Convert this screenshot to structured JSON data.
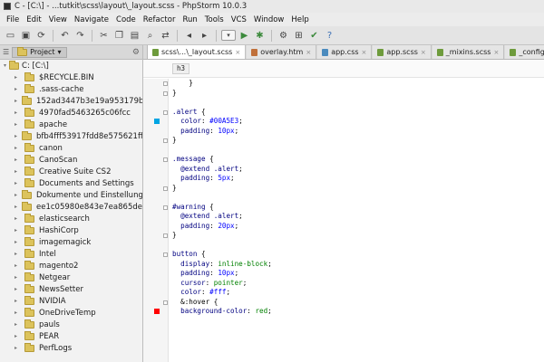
{
  "window": {
    "title": "C - [C:\\] - ...tutkit\\scss\\layout\\_layout.scss - PhpStorm 10.0.3"
  },
  "menu": [
    "File",
    "Edit",
    "View",
    "Navigate",
    "Code",
    "Refactor",
    "Run",
    "Tools",
    "VCS",
    "Window",
    "Help"
  ],
  "toolbar": {
    "icons": [
      "folder-open-icon",
      "save-icon",
      "sync-icon",
      "undo-icon",
      "redo-icon",
      "cut-icon",
      "copy-icon",
      "paste-icon",
      "find-icon",
      "replace-icon",
      "back-icon",
      "forward-icon",
      "run-config-icon",
      "run-icon",
      "debug-icon",
      "settings-icon",
      "project-structure-icon",
      "vcs-icon",
      "help-icon"
    ]
  },
  "project_panel": {
    "tab_label": "Project",
    "root": "C: [C:\\]",
    "items": [
      "$RECYCLE.BIN",
      ".sass-cache",
      "152ad3447b3e19a953179b5bbc7a",
      "4970fad5463265c06fcc",
      "apache",
      "bfb4fff53917fdd8e575621ff0286a",
      "canon",
      "CanoScan",
      "Creative Suite CS2",
      "Documents and Settings",
      "Dokumente und Einstellungen",
      "ee1c05980e843e7ea865de091f68b",
      "elasticsearch",
      "HashiCorp",
      "imagemagick",
      "Intel",
      "magento2",
      "Netgear",
      "NewsSetter",
      "NVIDIA",
      "OneDriveTemp",
      "pauls",
      "PEAR",
      "PerfLogs"
    ]
  },
  "tabs": [
    {
      "label": "scss\\...\\_layout.scss",
      "type": "scss",
      "active": true
    },
    {
      "label": "overlay.htm",
      "type": "html",
      "active": false
    },
    {
      "label": "app.css",
      "type": "css",
      "active": false
    },
    {
      "label": "app.scss",
      "type": "scss",
      "active": false
    },
    {
      "label": "_mixins.scss",
      "type": "scss",
      "active": false
    },
    {
      "label": "_config.scss",
      "type": "scss",
      "active": false
    }
  ],
  "breadcrumb": "h3",
  "code": {
    "lines": [
      [
        [
          "plain",
          "    }"
        ]
      ],
      [
        [
          "plain",
          "}"
        ]
      ],
      [
        [
          "plain",
          ""
        ]
      ],
      [
        [
          "selector",
          ".alert"
        ],
        [
          "plain",
          " {"
        ]
      ],
      [
        [
          "prop",
          "  color"
        ],
        [
          "plain",
          ": "
        ],
        [
          "num",
          "#00A5E3"
        ],
        [
          "plain",
          ";"
        ]
      ],
      [
        [
          "prop",
          "  padding"
        ],
        [
          "plain",
          ": "
        ],
        [
          "num",
          "10px"
        ],
        [
          "plain",
          ";"
        ]
      ],
      [
        [
          "plain",
          "}"
        ]
      ],
      [
        [
          "plain",
          ""
        ]
      ],
      [
        [
          "selector",
          ".message"
        ],
        [
          "plain",
          " {"
        ]
      ],
      [
        [
          "at",
          "  @extend"
        ],
        [
          "plain",
          " "
        ],
        [
          "selector",
          ".alert"
        ],
        [
          "plain",
          ";"
        ]
      ],
      [
        [
          "prop",
          "  padding"
        ],
        [
          "plain",
          ": "
        ],
        [
          "num",
          "5px"
        ],
        [
          "plain",
          ";"
        ]
      ],
      [
        [
          "plain",
          "}"
        ]
      ],
      [
        [
          "plain",
          ""
        ]
      ],
      [
        [
          "selector",
          "#warning"
        ],
        [
          "plain",
          " {"
        ]
      ],
      [
        [
          "at",
          "  @extend"
        ],
        [
          "plain",
          " "
        ],
        [
          "selector",
          ".alert"
        ],
        [
          "plain",
          ";"
        ]
      ],
      [
        [
          "prop",
          "  padding"
        ],
        [
          "plain",
          ": "
        ],
        [
          "num",
          "20px"
        ],
        [
          "plain",
          ";"
        ]
      ],
      [
        [
          "plain",
          "}"
        ]
      ],
      [
        [
          "plain",
          ""
        ]
      ],
      [
        [
          "selector",
          "button"
        ],
        [
          "plain",
          " {"
        ]
      ],
      [
        [
          "prop",
          "  display"
        ],
        [
          "plain",
          ": "
        ],
        [
          "val",
          "inline-block"
        ],
        [
          "plain",
          ";"
        ]
      ],
      [
        [
          "prop",
          "  padding"
        ],
        [
          "plain",
          ": "
        ],
        [
          "num",
          "10px"
        ],
        [
          "plain",
          ";"
        ]
      ],
      [
        [
          "prop",
          "  cursor"
        ],
        [
          "plain",
          ": "
        ],
        [
          "val",
          "pointer"
        ],
        [
          "plain",
          ";"
        ]
      ],
      [
        [
          "prop",
          "  color"
        ],
        [
          "plain",
          ": "
        ],
        [
          "num",
          "#fff"
        ],
        [
          "plain",
          ";"
        ]
      ],
      [
        [
          "plain",
          "  &:hover {"
        ]
      ],
      [
        [
          "prop",
          "  background-color"
        ],
        [
          "plain",
          ": "
        ],
        [
          "val",
          "red"
        ],
        [
          "plain",
          ";"
        ]
      ],
      [
        [
          "plain",
          ""
        ]
      ],
      [
        [
          "plain",
          ""
        ]
      ]
    ]
  },
  "swatches": [
    {
      "line": 4,
      "color": "#00A5E3"
    },
    {
      "line": 24,
      "color": "#ff0000"
    }
  ]
}
